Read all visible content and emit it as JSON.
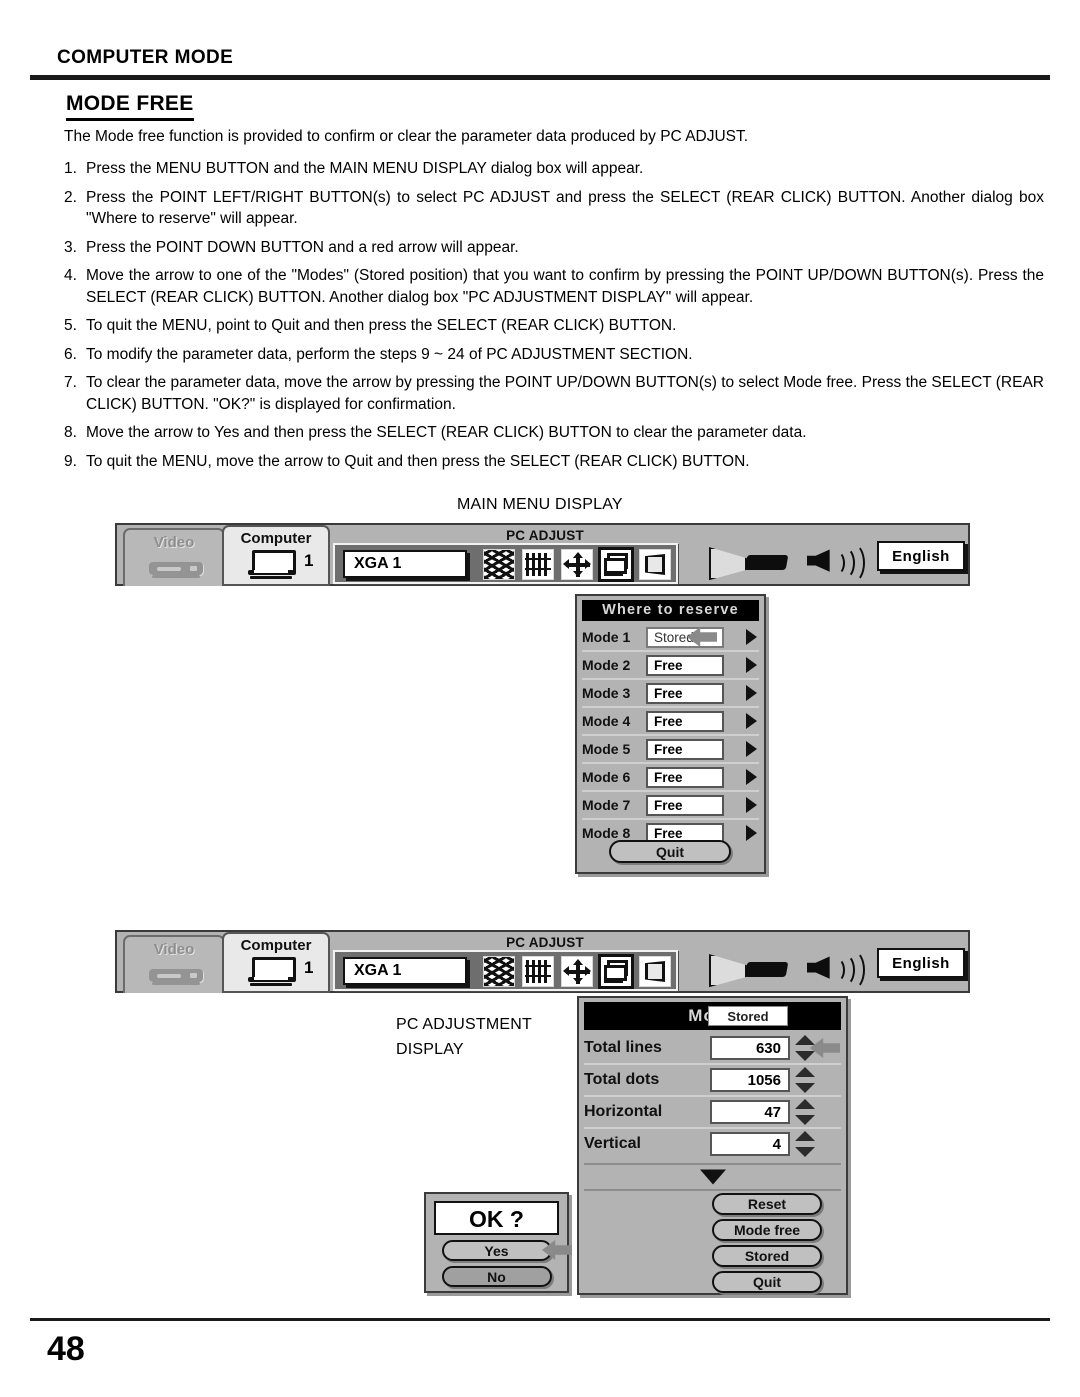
{
  "header": {
    "section": "COMPUTER MODE",
    "title": "MODE FREE"
  },
  "intro": "The Mode free function is provided to confirm or clear the parameter data produced by PC ADJUST.",
  "steps": [
    {
      "num": "1.",
      "text": "Press the MENU BUTTON and the MAIN MENU DISPLAY dialog box will appear."
    },
    {
      "num": "2.",
      "text": "Press the POINT LEFT/RIGHT BUTTON(s) to select PC ADJUST and press the SELECT (REAR CLICK) BUTTON. Another dialog box \"Where to reserve\" will appear."
    },
    {
      "num": "3.",
      "text": "Press the POINT DOWN BUTTON and a red arrow will appear."
    },
    {
      "num": "4.",
      "text": "Move the arrow to one of the \"Modes\" (Stored position) that you want to confirm by pressing the POINT UP/DOWN BUTTON(s). Press the SELECT (REAR CLICK) BUTTON. Another dialog box \"PC ADJUSTMENT DISPLAY\" will appear."
    },
    {
      "num": "5.",
      "text": "To quit the MENU, point to Quit and then press the SELECT (REAR CLICK) BUTTON."
    },
    {
      "num": "6.",
      "text": "To modify the parameter data, perform the steps 9 ~ 24 of PC ADJUSTMENT SECTION."
    },
    {
      "num": "7.",
      "text": "To clear the parameter data, move the arrow by pressing the POINT UP/DOWN BUTTON(s) to select Mode free. Press the SELECT (REAR CLICK) BUTTON. \"OK?\" is displayed for confirmation."
    },
    {
      "num": "8.",
      "text": "Move the arrow to Yes and then press the SELECT (REAR CLICK) BUTTON to clear the parameter data."
    },
    {
      "num": "9.",
      "text": "To quit the MENU, move the arrow to Quit and then press the SELECT (REAR CLICK) BUTTON."
    }
  ],
  "captions": {
    "main_menu_display": "MAIN MENU DISPLAY",
    "pc_adjustment_display_line1": "PC ADJUSTMENT",
    "pc_adjustment_display_line2": "DISPLAY"
  },
  "menubar": {
    "tab_video": "Video",
    "tab_computer": "Computer",
    "computer_number": "1",
    "menu_title": "PC ADJUST",
    "source_value": "XGA 1",
    "language_value": "English",
    "icons": [
      "fine-sync-icon",
      "total-dots-icon",
      "position-icon",
      "pc-adjust-icon",
      "keystone-icon"
    ]
  },
  "where_to_reserve": {
    "title": "Where to reserve",
    "rows": [
      {
        "label": "Mode 1",
        "value": "Stored"
      },
      {
        "label": "Mode 2",
        "value": "Free"
      },
      {
        "label": "Mode 3",
        "value": "Free"
      },
      {
        "label": "Mode 4",
        "value": "Free"
      },
      {
        "label": "Mode 5",
        "value": "Free"
      },
      {
        "label": "Mode 6",
        "value": "Free"
      },
      {
        "label": "Mode 7",
        "value": "Free"
      },
      {
        "label": "Mode 8",
        "value": "Free"
      }
    ],
    "quit_label": "Quit"
  },
  "pc_adjustment": {
    "mode_label": "Mode",
    "mode_value": "Stored",
    "rows": [
      {
        "label": "Total lines",
        "value": "630"
      },
      {
        "label": "Total dots",
        "value": "1056"
      },
      {
        "label": "Horizontal",
        "value": "47"
      },
      {
        "label": "Vertical",
        "value": "4"
      }
    ],
    "buttons": [
      "Reset",
      "Mode free",
      "Stored",
      "Quit"
    ]
  },
  "ok_dialog": {
    "title": "OK ?",
    "yes_label": "Yes",
    "no_label": "No"
  },
  "page_number": "48",
  "colors": {
    "osd_gray": "#b3b3b3",
    "osd_dark": "#6e6e6e",
    "title_bar": "#000000",
    "arrow": "#8a8a8a"
  }
}
